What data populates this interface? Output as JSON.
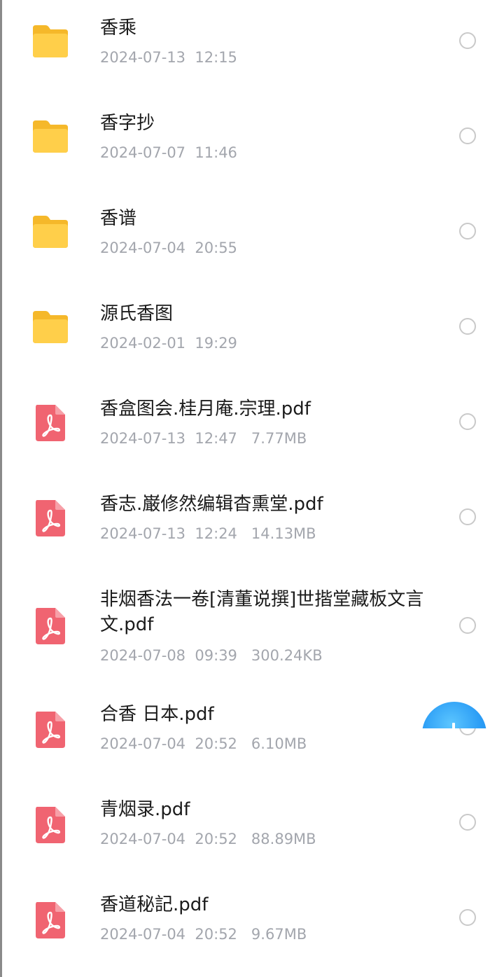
{
  "items": [
    {
      "type": "folder",
      "name": "香乘",
      "meta": "2024-07-13  12:15"
    },
    {
      "type": "folder",
      "name": "香字抄",
      "meta": "2024-07-07  11:46"
    },
    {
      "type": "folder",
      "name": "香谱",
      "meta": "2024-07-04  20:55"
    },
    {
      "type": "folder",
      "name": "源氏香图",
      "meta": "2024-02-01  19:29"
    },
    {
      "type": "pdf",
      "name": "香盒图会.桂月庵.宗理.pdf",
      "meta": "2024-07-13  12:47   7.77MB"
    },
    {
      "type": "pdf",
      "name": "香志.巌修然编辑杳熏堂.pdf",
      "meta": "2024-07-13  12:24   14.13MB"
    },
    {
      "type": "pdf",
      "name": "非烟香法一卷[清董说撰]世揩堂藏板文言文.pdf",
      "meta": "2024-07-08  09:39   300.24KB"
    },
    {
      "type": "pdf",
      "name": "合香 日本.pdf",
      "meta": "2024-07-04  20:52   6.10MB"
    },
    {
      "type": "pdf",
      "name": "青烟录.pdf",
      "meta": "2024-07-04  20:52   88.89MB"
    },
    {
      "type": "pdf",
      "name": "香道秘記.pdf",
      "meta": "2024-07-04  20:52   9.67MB"
    }
  ],
  "colors": {
    "folder": "#ffc93c",
    "pdf": "#f06471",
    "meta_text": "#a3a6ad",
    "fab": "#2a9cf5"
  },
  "fab": {
    "icon": "add-icon"
  }
}
